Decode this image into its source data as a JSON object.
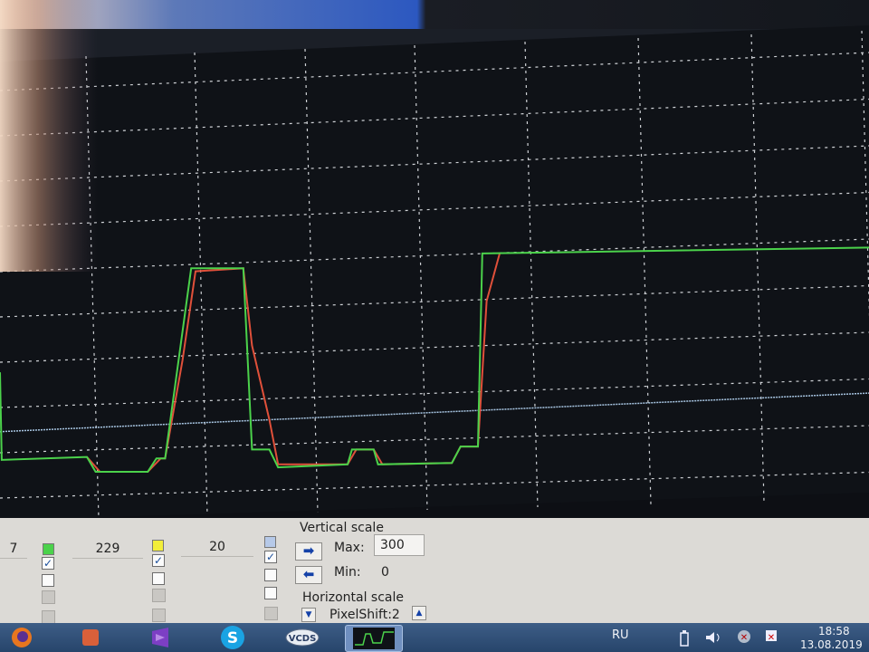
{
  "colors": {
    "plot_background": "#0f1217",
    "grid": "#cfd2d6",
    "series_green": "#4bd24b",
    "series_red": "#e0503a",
    "series_blue": "#a9c7e4"
  },
  "controls": {
    "ch1_value": "7",
    "ch2_value": "229",
    "ch3_value": "20",
    "vertical_scale_label": "Vertical scale",
    "max_label": "Max:",
    "max_value": "300",
    "min_label": "Min:",
    "min_value": "0",
    "horizontal_scale_label": "Horizontal scale",
    "pixelshift_label": "PixelShift:2"
  },
  "taskbar": {
    "apps": [
      "firefox-icon",
      "app-icon",
      "visual-studio-icon",
      "skype-icon",
      "vcds-icon",
      "graph-window-icon"
    ],
    "vcds_label": "VCDS",
    "skype_label": "S",
    "language": "RU",
    "time": "18:58",
    "date": "13.08.2019"
  },
  "chart_data": {
    "type": "line",
    "title": "",
    "xlabel": "",
    "ylabel": "",
    "xlim": [
      0,
      100
    ],
    "ylim": [
      0,
      300
    ],
    "grid": true,
    "series": [
      {
        "color": "green",
        "points": [
          [
            0,
            92
          ],
          [
            0.2,
            33
          ],
          [
            10,
            35
          ],
          [
            11,
            25
          ],
          [
            17,
            25
          ],
          [
            18,
            34
          ],
          [
            19,
            34
          ],
          [
            22,
            162
          ],
          [
            28,
            162
          ],
          [
            29,
            40
          ],
          [
            31,
            40
          ],
          [
            32,
            28
          ],
          [
            40,
            30
          ],
          [
            40.5,
            40
          ],
          [
            43,
            40
          ],
          [
            43.5,
            30
          ],
          [
            52,
            31
          ],
          [
            53,
            42
          ],
          [
            55,
            42
          ],
          [
            55.5,
            172
          ],
          [
            100,
            176
          ]
        ]
      },
      {
        "color": "red",
        "points": [
          [
            10,
            35
          ],
          [
            11.5,
            25
          ],
          [
            17,
            25
          ],
          [
            18.5,
            34
          ],
          [
            19,
            34
          ],
          [
            21,
            100
          ],
          [
            22.5,
            160
          ],
          [
            28,
            162
          ],
          [
            29,
            110
          ],
          [
            31,
            60
          ],
          [
            32,
            30
          ],
          [
            40,
            30
          ],
          [
            41,
            40
          ],
          [
            43,
            40
          ],
          [
            44,
            30
          ],
          [
            52,
            31
          ],
          [
            53,
            42
          ],
          [
            55,
            42
          ],
          [
            56,
            140
          ],
          [
            57.5,
            172
          ]
        ]
      },
      {
        "color": "blue",
        "points": [
          [
            0,
            52
          ],
          [
            100,
            78
          ]
        ]
      }
    ]
  }
}
